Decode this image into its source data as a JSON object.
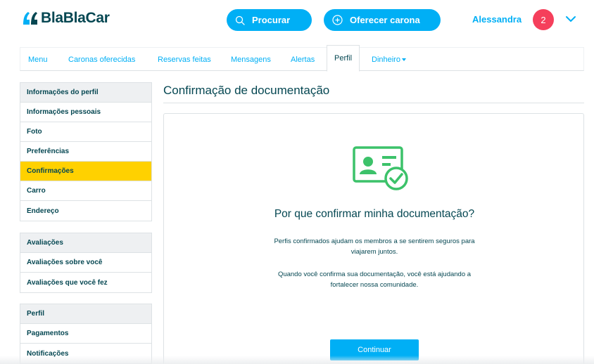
{
  "header": {
    "logo_text": "BlaBlaCar",
    "search_label": "Procurar",
    "offer_label": "Oferecer carona",
    "user_name": "Alessandra",
    "notification_count": "2"
  },
  "tabs": [
    {
      "label": "Menu"
    },
    {
      "label": "Caronas oferecidas"
    },
    {
      "label": "Reservas feitas"
    },
    {
      "label": "Mensagens"
    },
    {
      "label": "Alertas"
    },
    {
      "label": "Perfil"
    },
    {
      "label": "Dinheiro"
    }
  ],
  "active_tab": "Perfil",
  "sidebar": {
    "profile": {
      "heading": "Informações do perfil",
      "items": [
        "Informações pessoais",
        "Foto",
        "Preferências",
        "Confirmações",
        "Carro",
        "Endereço"
      ]
    },
    "ratings": {
      "heading": "Avaliações",
      "items": [
        "Avaliações sobre você",
        "Avaliações que você fez"
      ]
    },
    "account": {
      "heading": "Perfil",
      "items": [
        "Pagamentos",
        "Notificações"
      ]
    },
    "active_item": "Confirmações"
  },
  "main": {
    "title": "Confirmação de documentação",
    "card_title": "Por que confirmar minha documentação?",
    "text1_line1": "Perfis confirmados ajudam os membros a se sentirem seguros para",
    "text1_line2": "viajarem juntos.",
    "text2_line1": "Quando você confirma sua documentação, você está ajudando a",
    "text2_line2": "fortalecer nossa comunidade.",
    "continue_label": "Continuar"
  },
  "colors": {
    "brand_blue": "#00aff5",
    "text_dark": "#054752",
    "active_yellow": "#ffd100",
    "badge_red": "#f53f5b",
    "icon_green": "#3cc26a"
  }
}
